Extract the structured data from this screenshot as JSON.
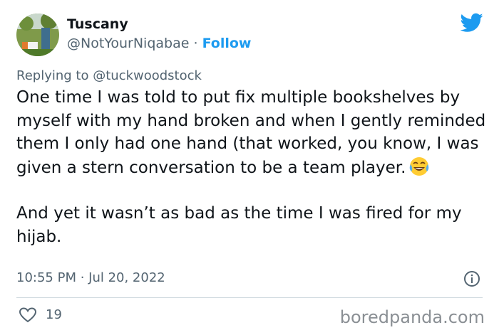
{
  "tweet": {
    "author": {
      "display_name": "Tuscany",
      "handle": "@NotYourNiqabae",
      "separator": " · ",
      "follow_label": "Follow"
    },
    "replying_prefix": "Replying to ",
    "replying_to": "@tuckwoodstock",
    "paragraph_1": "One time I was told to put fix multiple bookshelves by myself with my hand broken and when I gently reminded them I only had one hand (that worked, you know, I was given a stern conversation to be a team player.",
    "paragraph_1_emoji": "face-with-tears-of-joy",
    "paragraph_2": "And yet it wasn’t as bad as the time I was fired for my hijab.",
    "timestamp": "10:55 PM · Jul 20, 2022",
    "like_count": "19"
  },
  "icons": {
    "brand": "twitter-bird-icon",
    "info": "info-icon",
    "like": "heart-icon"
  },
  "colors": {
    "accent": "#1d9bf0",
    "text": "#0f1419",
    "muted": "#536471",
    "divider": "#cfd9de"
  },
  "watermark": "boredpanda.com"
}
